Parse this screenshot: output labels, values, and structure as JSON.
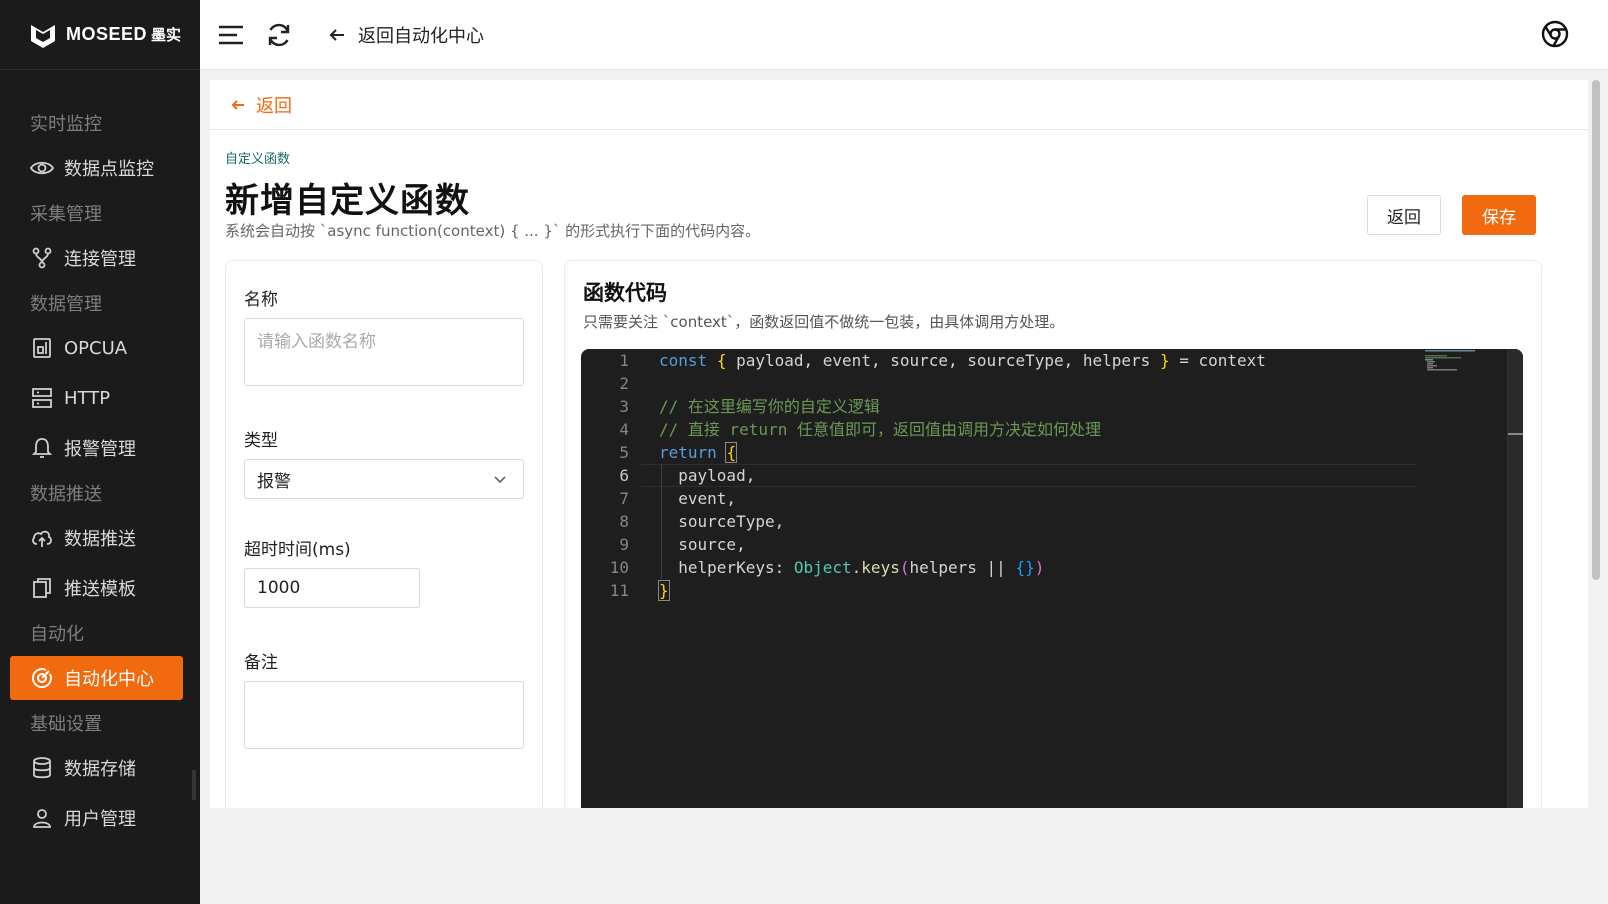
{
  "brand": {
    "name": "MOSEED",
    "cn": "墨实"
  },
  "sidebar": {
    "groups": [
      {
        "title": "实时监控",
        "items": [
          {
            "label": "数据点监控",
            "icon": "eye-icon"
          }
        ]
      },
      {
        "title": "采集管理",
        "items": [
          {
            "label": "连接管理",
            "icon": "branch-icon"
          }
        ]
      },
      {
        "title": "数据管理",
        "items": [
          {
            "label": "OPCUA",
            "icon": "device-icon"
          },
          {
            "label": "HTTP",
            "icon": "server-icon"
          },
          {
            "label": "报警管理",
            "icon": "bell-icon"
          }
        ]
      },
      {
        "title": "数据推送",
        "items": [
          {
            "label": "数据推送",
            "icon": "cloud-upload-icon"
          },
          {
            "label": "推送模板",
            "icon": "copy-icon"
          }
        ]
      },
      {
        "title": "自动化",
        "items": [
          {
            "label": "自动化中心",
            "icon": "target-icon",
            "active": true
          }
        ]
      },
      {
        "title": "基础设置",
        "items": [
          {
            "label": "数据存储",
            "icon": "database-icon"
          },
          {
            "label": "用户管理",
            "icon": "user-icon"
          }
        ]
      }
    ]
  },
  "topbar": {
    "back_label": "返回自动化中心"
  },
  "main": {
    "back_label": "返回",
    "crumb": "自定义函数",
    "title": "新增自定义函数",
    "desc": "系统会自动按 `async function(context) { ... }` 的形式执行下面的代码内容。",
    "btn_back": "返回",
    "btn_save": "保存"
  },
  "form": {
    "name_label": "名称",
    "name_placeholder": "请输入函数名称",
    "type_label": "类型",
    "type_value": "报警",
    "timeout_label": "超时时间(ms)",
    "timeout_value": "1000",
    "remark_label": "备注"
  },
  "code_card": {
    "title": "函数代码",
    "desc": "只需要关注 `context`，函数返回值不做统一包装，由具体调用方处理。"
  },
  "colors": {
    "accent": "#f26a10",
    "sidebar_bg": "#1b1b1b",
    "editor_bg": "#1e1e1e"
  }
}
